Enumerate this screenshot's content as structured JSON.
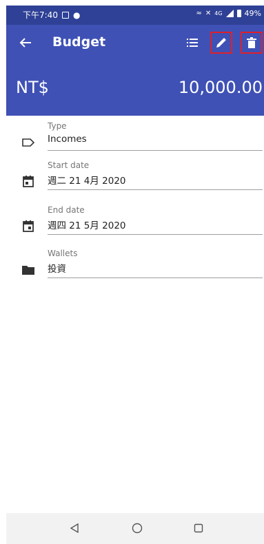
{
  "status_bar": {
    "time": "下午7:40",
    "network": "4G",
    "battery": "49%"
  },
  "app_bar": {
    "title": "Budget"
  },
  "header": {
    "currency": "NT$",
    "amount": "10,000.00"
  },
  "fields": [
    {
      "label": "Type",
      "value": "Incomes",
      "icon": "label-outline-icon"
    },
    {
      "label": "Start date",
      "value": "週二 21 4月 2020",
      "icon": "calendar-icon"
    },
    {
      "label": "End date",
      "value": "週四 21 5月 2020",
      "icon": "calendar-icon"
    },
    {
      "label": "Wallets",
      "value": "投資",
      "icon": "folder-icon"
    }
  ],
  "colors": {
    "status_bar": "#2f4196",
    "primary": "#3f51b5",
    "highlight": "#e0202a"
  }
}
